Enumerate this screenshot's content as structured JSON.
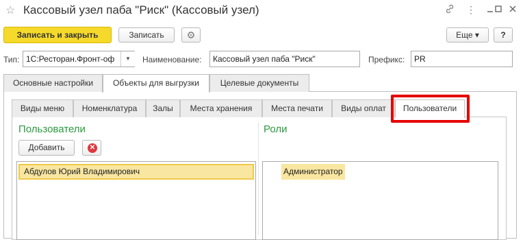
{
  "window": {
    "title": "Кассовый узел паба \"Риск\" (Кассовый узел)",
    "star_icon": "☆",
    "link_icon": "🔗",
    "menu_icon": "⋮",
    "minimize_icon": "—",
    "maximize_icon": "☐",
    "close_icon": "✕"
  },
  "toolbar": {
    "write_close_label": "Записать и закрыть",
    "write_label": "Записать",
    "settings_icon": "⚙",
    "more_label": "Еще ▾",
    "help_label": "?"
  },
  "fields": {
    "type_label": "Тип:",
    "type_value": "1С:Ресторан.Фронт-оф",
    "type_dropdown": "▼",
    "name_label": "Наименование:",
    "name_value": "Кассовый узел паба \"Риск\"",
    "prefix_label": "Префикс:",
    "prefix_value": "PR"
  },
  "tabs": [
    {
      "label": "Основные настройки"
    },
    {
      "label": "Объекты для выгрузки"
    },
    {
      "label": "Целевые документы"
    }
  ],
  "subtabs": [
    {
      "label": "Виды меню"
    },
    {
      "label": "Номенклатура"
    },
    {
      "label": "Залы"
    },
    {
      "label": "Места хранения"
    },
    {
      "label": "Места печати"
    },
    {
      "label": "Виды оплат"
    },
    {
      "label": "Пользователи"
    }
  ],
  "users": {
    "title": "Пользователи",
    "add_label": "Добавить",
    "remove_icon": "✕",
    "rows": [
      "Абдулов Юрий Владимирович"
    ]
  },
  "roles": {
    "title": "Роли",
    "rows": [
      "Администратор"
    ]
  },
  "colors": {
    "accent_button": "#f5d92b",
    "section_title": "#2a9a3f",
    "highlight_frame": "#e60000",
    "selected_row": "#f9e6a0"
  }
}
